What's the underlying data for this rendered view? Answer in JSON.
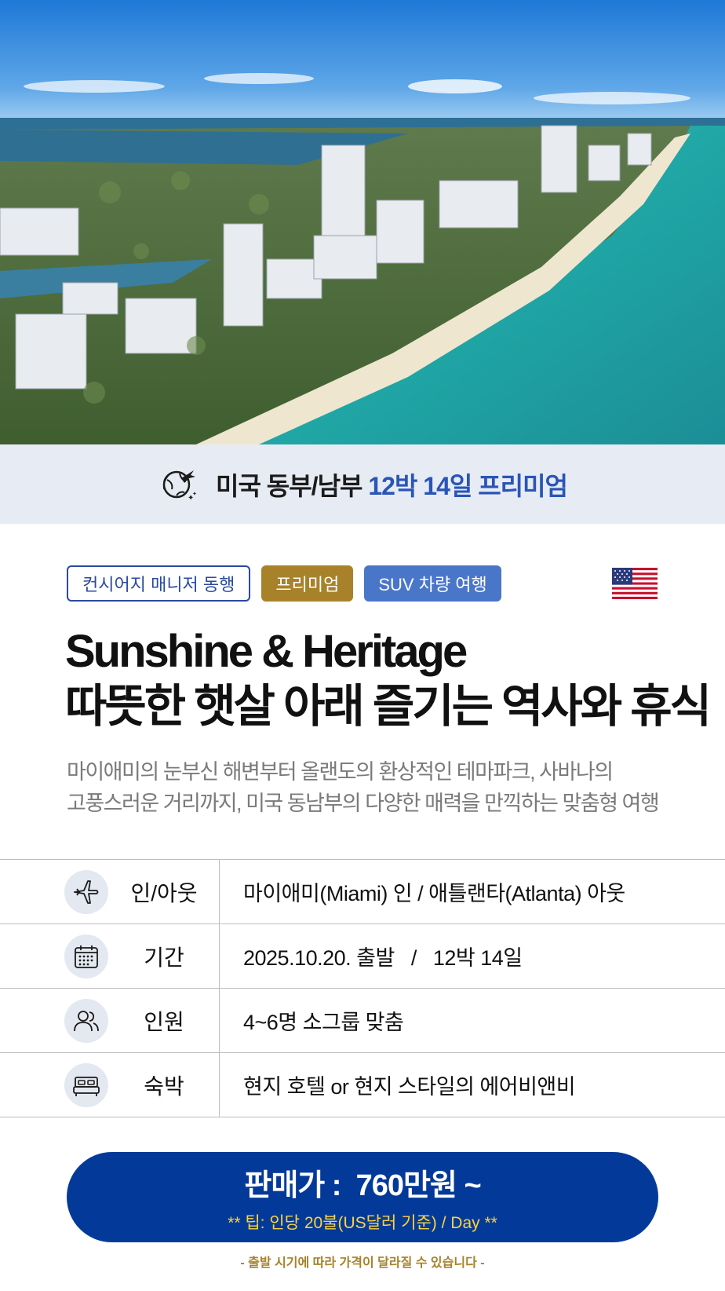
{
  "hero": {
    "image": "aerial-beach-city-photo"
  },
  "banner": {
    "icon": "globe-plane-icon",
    "title_dark": "미국 동부/남부",
    "title_blue": "12박 14일 프리미엄"
  },
  "tags": [
    {
      "label": "컨시어지 매니저 동행",
      "style": "outline"
    },
    {
      "label": "프리미엄",
      "style": "gold"
    },
    {
      "label": "SUV 차량 여행",
      "style": "blue"
    }
  ],
  "flag": "us-flag-icon",
  "headline": {
    "line1": "Sunshine & Heritage",
    "line2": "따뜻한 햇살 아래 즐기는 역사와 휴식"
  },
  "description": {
    "line1": "마이애미의 눈부신 해변부터 올랜도의 환상적인 테마파크, 사바나의",
    "line2": "고풍스러운 거리까지, 미국 동남부의 다양한 매력을 만끽하는 맞춤형 여행"
  },
  "info": [
    {
      "icon": "airplane-icon",
      "label": "인/아웃",
      "value": "마이애미(Miami) 인 / 애틀랜타(Atlanta) 아웃"
    },
    {
      "icon": "calendar-icon",
      "label": "기간",
      "value": "2025.10.20. 출발   /   12박 14일"
    },
    {
      "icon": "people-icon",
      "label": "인원",
      "value": "4~6명 소그룹 맞춤"
    },
    {
      "icon": "bed-icon",
      "label": "숙박",
      "value": "현지 호텔 or 현지 스타일의 에어비앤비"
    }
  ],
  "price": {
    "main": "판매가 :  760만원 ~",
    "tip": "** 팁: 인당 20불(US달러 기준) / Day **"
  },
  "note": "- 출발 시기에 따라 가격이 달라질 수 있습니다 -",
  "colors": {
    "accent_blue": "#2a55b8",
    "price_bg": "#033a9a",
    "gold": "#a8822a",
    "tip_yellow": "#ffd33a"
  }
}
